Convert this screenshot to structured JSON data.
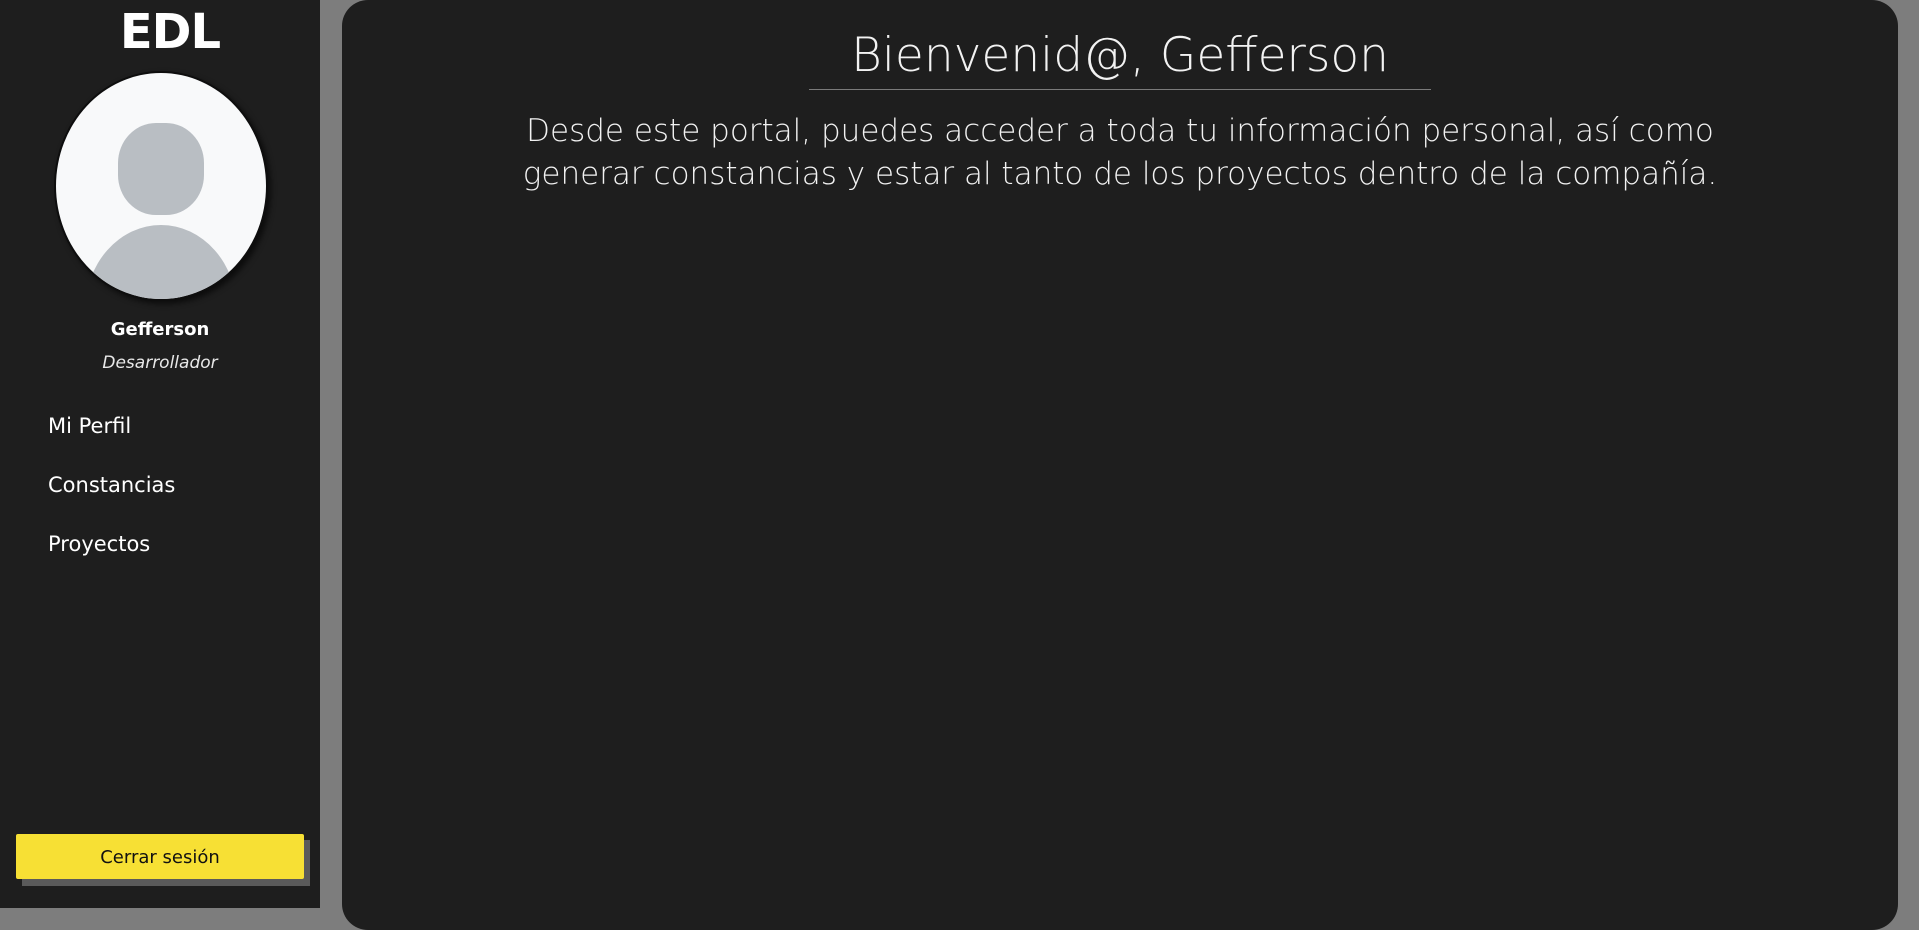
{
  "sidebar": {
    "logo": "EDL",
    "user": {
      "name": "Gefferson",
      "role": "Desarrollador"
    },
    "nav_items": [
      {
        "label": "Mi Perfil"
      },
      {
        "label": "Constancias"
      },
      {
        "label": "Proyectos"
      }
    ],
    "logout_label": "Cerrar sesión"
  },
  "main": {
    "title": "Bienvenid@, Gefferson",
    "intro": "Desde este portal, puedes acceder a toda tu información personal, así como generar constancias y estar al tanto de los proyectos dentro de la compañía."
  },
  "colors": {
    "background": "#7d7d7d",
    "panel": "#1e1e1e",
    "accent": "#f7e034",
    "avatar_bg": "#f8f9fa",
    "avatar_silhouette": "#b9bec3"
  },
  "icons": {
    "avatar": "user-placeholder-icon"
  }
}
